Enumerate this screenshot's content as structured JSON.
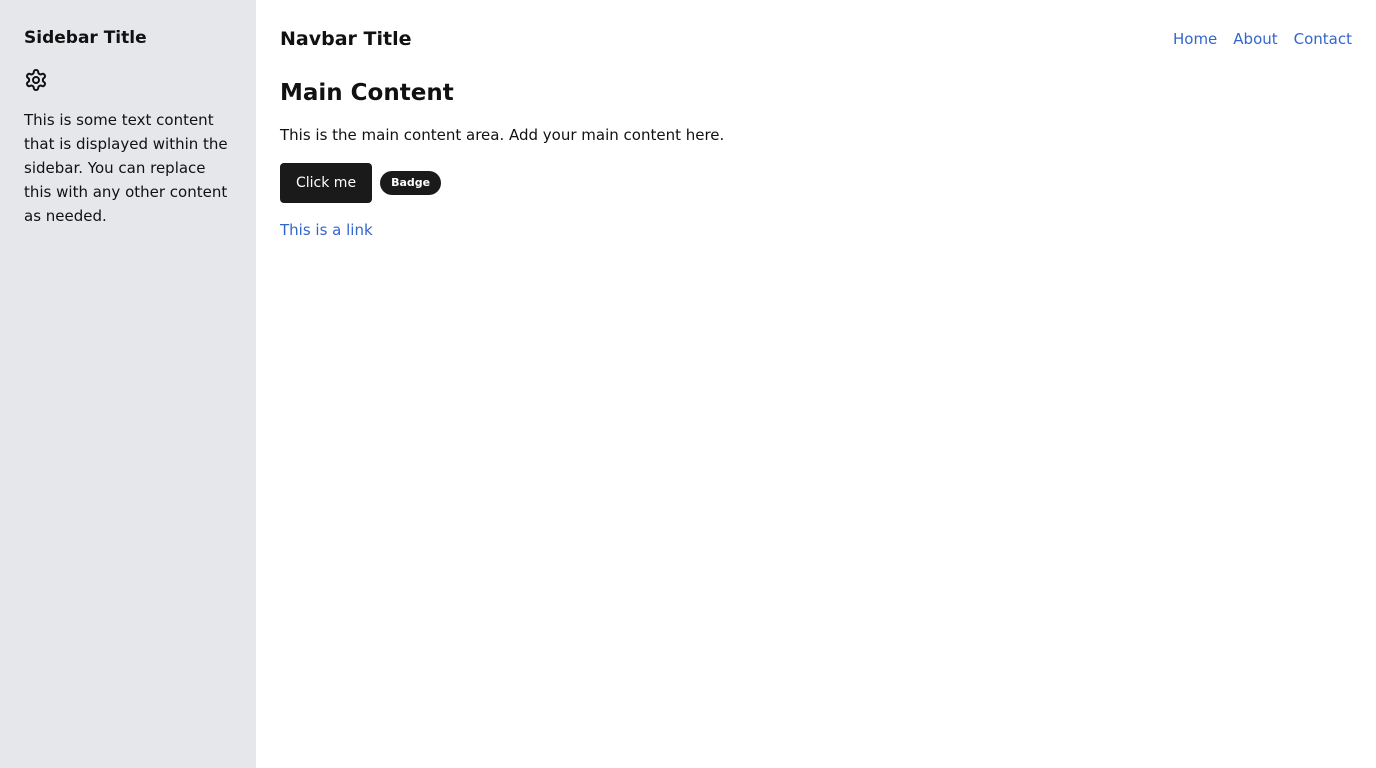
{
  "sidebar": {
    "title": "Sidebar Title",
    "icon": "gear-icon",
    "text": "This is some text content that is displayed within the sidebar. You can replace this with any other content as needed."
  },
  "navbar": {
    "title": "Navbar Title",
    "links": [
      {
        "label": "Home"
      },
      {
        "label": "About"
      },
      {
        "label": "Contact"
      }
    ]
  },
  "main": {
    "title": "Main Content",
    "text": "This is the main content area. Add your main content here.",
    "button_label": "Click me",
    "badge_label": "Badge",
    "link_text": "This is a link"
  },
  "colors": {
    "sidebar_bg": "#e5e7eb",
    "link": "#3366cc",
    "button_bg": "#1a1a1a"
  }
}
